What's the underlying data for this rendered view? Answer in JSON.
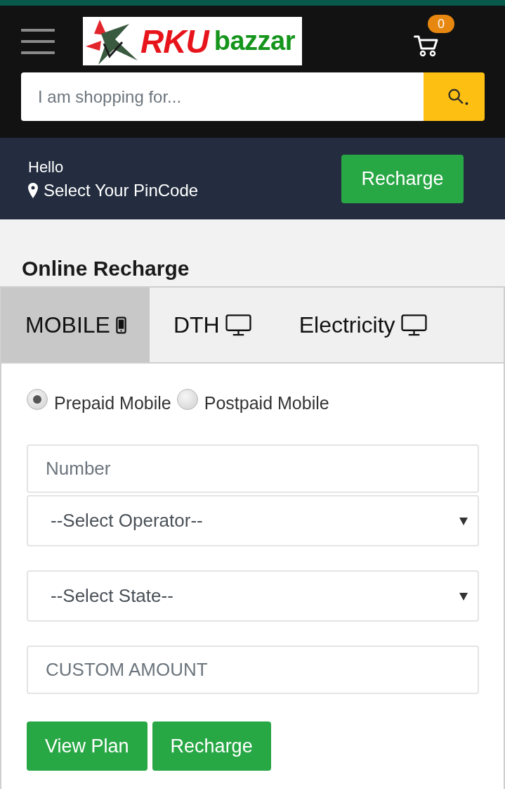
{
  "header": {
    "logo": {
      "brand": "RKU",
      "suffix": "bazzar"
    },
    "cart": {
      "count": "0"
    },
    "search": {
      "placeholder": "I am shopping for..."
    }
  },
  "location_bar": {
    "greeting": "Hello",
    "pincode": "Select Your PinCode",
    "button": "Recharge"
  },
  "section_title": "Online Recharge",
  "tabs": [
    {
      "label": "MOBILE",
      "kind": "phone",
      "selected": true
    },
    {
      "label": "DTH",
      "kind": "screen",
      "selected": false
    },
    {
      "label": "Electricity",
      "kind": "screen",
      "selected": false
    }
  ],
  "plan_type": [
    {
      "label": "Prepaid Mobile",
      "selected": true
    },
    {
      "label": "Postpaid Mobile",
      "selected": false
    }
  ],
  "form_fields": [
    {
      "kind": "input",
      "placeholder": "Number"
    },
    {
      "kind": "select",
      "value": "--Select Operator--"
    },
    {
      "kind": "select",
      "value": "--Select State--"
    },
    {
      "kind": "input",
      "placeholder": "CUSTOM AMOUNT"
    }
  ],
  "buttons": [
    "View Plan",
    "Recharge"
  ]
}
